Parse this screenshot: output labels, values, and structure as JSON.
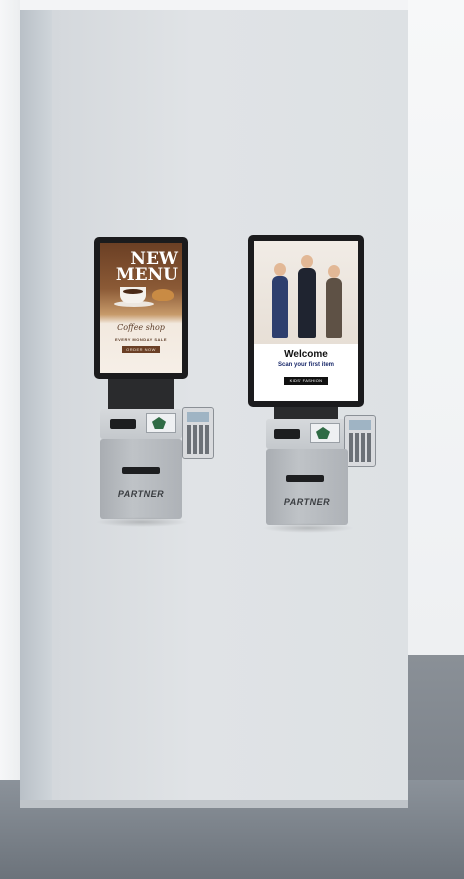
{
  "kiosks": [
    {
      "screen": {
        "headline_line1": "NEW",
        "headline_line2": "MENU",
        "script_title": "Coffee shop",
        "subtitle": "EVERY MONDAY SALE",
        "button": "ORDER NOW"
      },
      "brand": "PARTNER"
    },
    {
      "screen": {
        "title": "Welcome",
        "subtitle": "Scan your first item",
        "button": "KIDS' FASHION STORE"
      },
      "brand": "PARTNER"
    }
  ],
  "colors": {
    "wall": "#dde1e4",
    "floor": "#767d85",
    "kiosk_frame": "#1b1b1d",
    "kiosk_body": "#bfc3c7",
    "coffee_brown": "#6a3f25",
    "welcome_navy": "#1b2a6b"
  }
}
